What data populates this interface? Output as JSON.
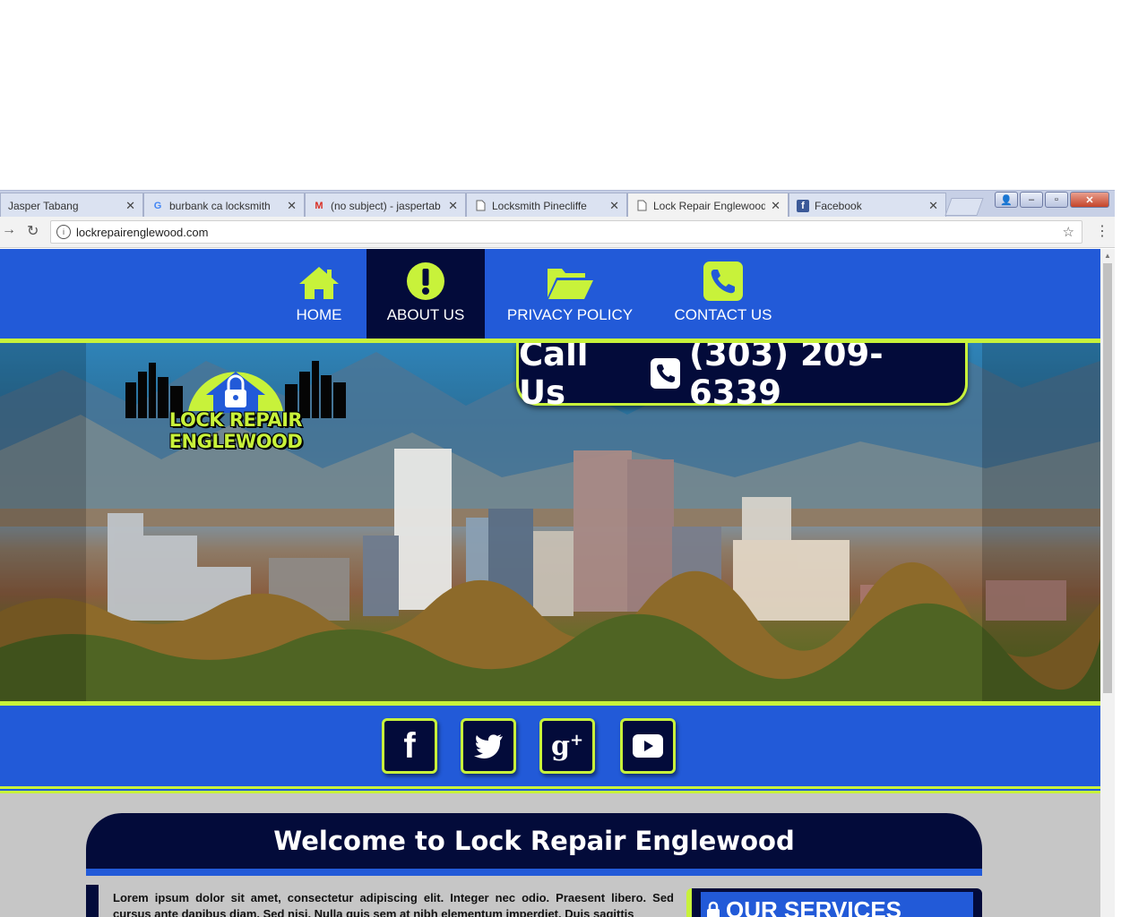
{
  "browser": {
    "tabs": [
      {
        "title": "Jasper Tabang",
        "favicon": "none"
      },
      {
        "title": "burbank ca locksmith",
        "favicon": "google-icon"
      },
      {
        "title": "(no subject) - jaspertab",
        "favicon": "gmail-icon"
      },
      {
        "title": "Locksmith Pinecliffe",
        "favicon": "page-icon"
      },
      {
        "title": "Lock Repair Englewood",
        "favicon": "page-icon",
        "active": true
      },
      {
        "title": "Facebook",
        "favicon": "facebook-icon"
      }
    ],
    "url": "lockrepairenglewood.com"
  },
  "nav": {
    "items": [
      {
        "label": "HOME",
        "icon": "home-icon"
      },
      {
        "label": "ABOUT US",
        "icon": "exclamation-icon",
        "active": true
      },
      {
        "label": "PRIVACY POLICY",
        "icon": "folder-icon"
      },
      {
        "label": "CONTACT US",
        "icon": "phone-icon"
      }
    ]
  },
  "hero": {
    "logo_text": "LOCK REPAIR ENGLEWOOD",
    "call_prefix": "Call Us",
    "phone": "(303) 209-6339"
  },
  "social": [
    "facebook-icon",
    "twitter-icon",
    "google-plus-icon",
    "youtube-icon"
  ],
  "content": {
    "welcome_title": "Welcome to Lock Repair Englewood",
    "paragraph": "Lorem ipsum dolor sit amet, consectetur adipiscing elit. Integer nec odio. Praesent libero. Sed cursus ante dapibus diam. Sed nisi. Nulla quis sem at nibh elementum imperdiet. Duis sagittis",
    "services_title": "OUR SERVICES"
  },
  "colors": {
    "brand_blue": "#225ad8",
    "navy": "#030b3a",
    "lime": "#c8f23a"
  }
}
